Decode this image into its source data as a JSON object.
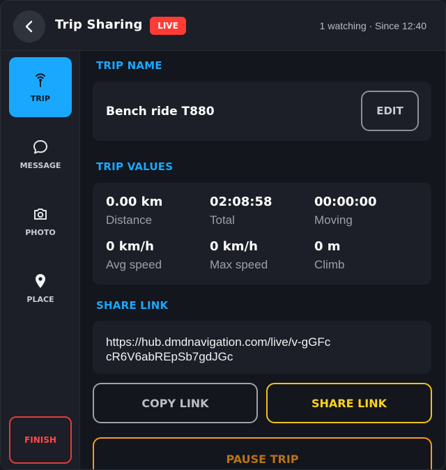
{
  "header": {
    "title": "Trip Sharing",
    "live_badge": "LIVE",
    "status": "1 watching · Since 12:40"
  },
  "sidebar": {
    "items": [
      {
        "label": "TRIP",
        "icon": "broadcast-icon",
        "active": true
      },
      {
        "label": "MESSAGE",
        "icon": "message-icon",
        "active": false
      },
      {
        "label": "PHOTO",
        "icon": "camera-icon",
        "active": false
      },
      {
        "label": "PLACE",
        "icon": "map-pin-icon",
        "active": false
      }
    ],
    "finish_label": "FINISH"
  },
  "trip_name": {
    "section_label": "TRIP NAME",
    "value": "Bench ride T880",
    "edit_label": "EDIT"
  },
  "trip_values": {
    "section_label": "TRIP VALUES",
    "stats": [
      {
        "value": "0.00 km",
        "label": "Distance"
      },
      {
        "value": "02:08:58",
        "label": "Total"
      },
      {
        "value": "00:00:00",
        "label": "Moving"
      },
      {
        "value": "0 km/h",
        "label": "Avg speed"
      },
      {
        "value": "0 km/h",
        "label": "Max speed"
      },
      {
        "value": "0 m",
        "label": "Climb"
      }
    ]
  },
  "share": {
    "section_label": "SHARE LINK",
    "url": "https://hub.dmdnavigation.com/live/v-gGFccR6V6abREpSb7gdJGc",
    "copy_label": "COPY LINK",
    "share_label": "SHARE LINK"
  },
  "pause_label": "PAUSE TRIP",
  "colors": {
    "accent_blue": "#1aa8ff",
    "live_red": "#ff3b35",
    "share_yellow": "#ffd21f",
    "pause_orange": "#ff9a1a",
    "finish_red": "#e23b3b"
  }
}
